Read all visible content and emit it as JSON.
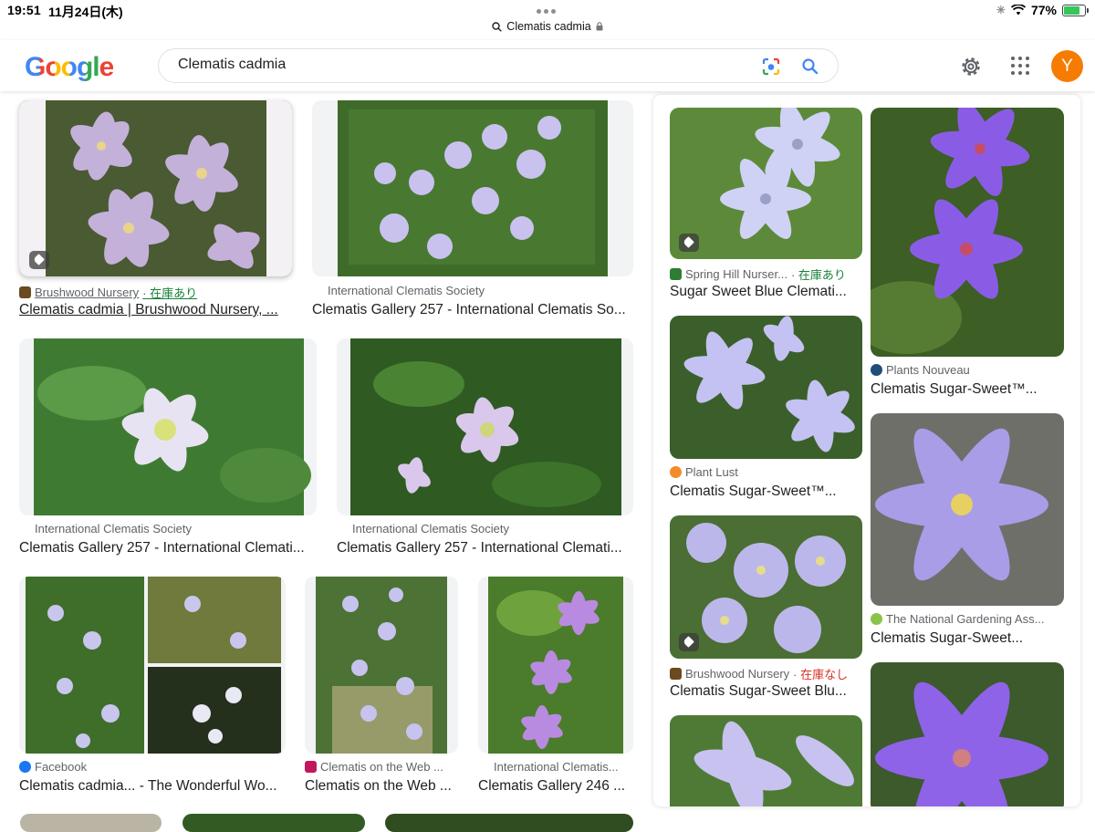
{
  "status_bar": {
    "time": "19:51",
    "date": "11月24日(木)",
    "battery": "77%"
  },
  "browser": {
    "url_label": "Clematis cadmia"
  },
  "search": {
    "logo": "Google",
    "query": "Clematis cadmia",
    "avatar_letter": "Y"
  },
  "results": [
    {
      "source": "Brushwood Nursery",
      "stock": "· 在庫あり",
      "title": "Clematis cadmia | Brushwood Nursery, ..."
    },
    {
      "source": "International Clematis Society",
      "stock": "",
      "title": "Clematis Gallery 257 - International Clematis So..."
    },
    {
      "source": "International Clematis Society",
      "stock": "",
      "title": "Clematis Gallery 257 - International Clemati..."
    },
    {
      "source": "International Clematis Society",
      "stock": "",
      "title": "Clematis Gallery 257 - International Clemati..."
    },
    {
      "source": "Facebook",
      "stock": "",
      "title": "Clematis cadmia... - The Wonderful Wo..."
    },
    {
      "source": "Clematis on the Web ...",
      "stock": "",
      "title": "Clematis on the Web ..."
    },
    {
      "source": "International Clematis...",
      "stock": "",
      "title": "Clematis Gallery 246 ..."
    }
  ],
  "related": [
    {
      "source": "Spring Hill Nurser...",
      "stock": "· 在庫あり",
      "title": "Sugar Sweet Blue Clemati..."
    },
    {
      "source": "Plants Nouveau",
      "stock": "",
      "title": "Clematis Sugar-Sweet™..."
    },
    {
      "source": "Plant Lust",
      "stock": "",
      "title": "Clematis Sugar-Sweet™..."
    },
    {
      "source": "The National Gardening Ass...",
      "stock": "",
      "title": "Clematis Sugar-Sweet..."
    },
    {
      "source": "Brushwood Nursery",
      "stock": "· 在庫なし",
      "title": "Clematis Sugar-Sweet Blu..."
    }
  ],
  "colors": {
    "accent_blue": "#4285f4",
    "in_stock": "#188038",
    "out_of_stock": "#d93025",
    "avatar_bg": "#f57c00"
  }
}
